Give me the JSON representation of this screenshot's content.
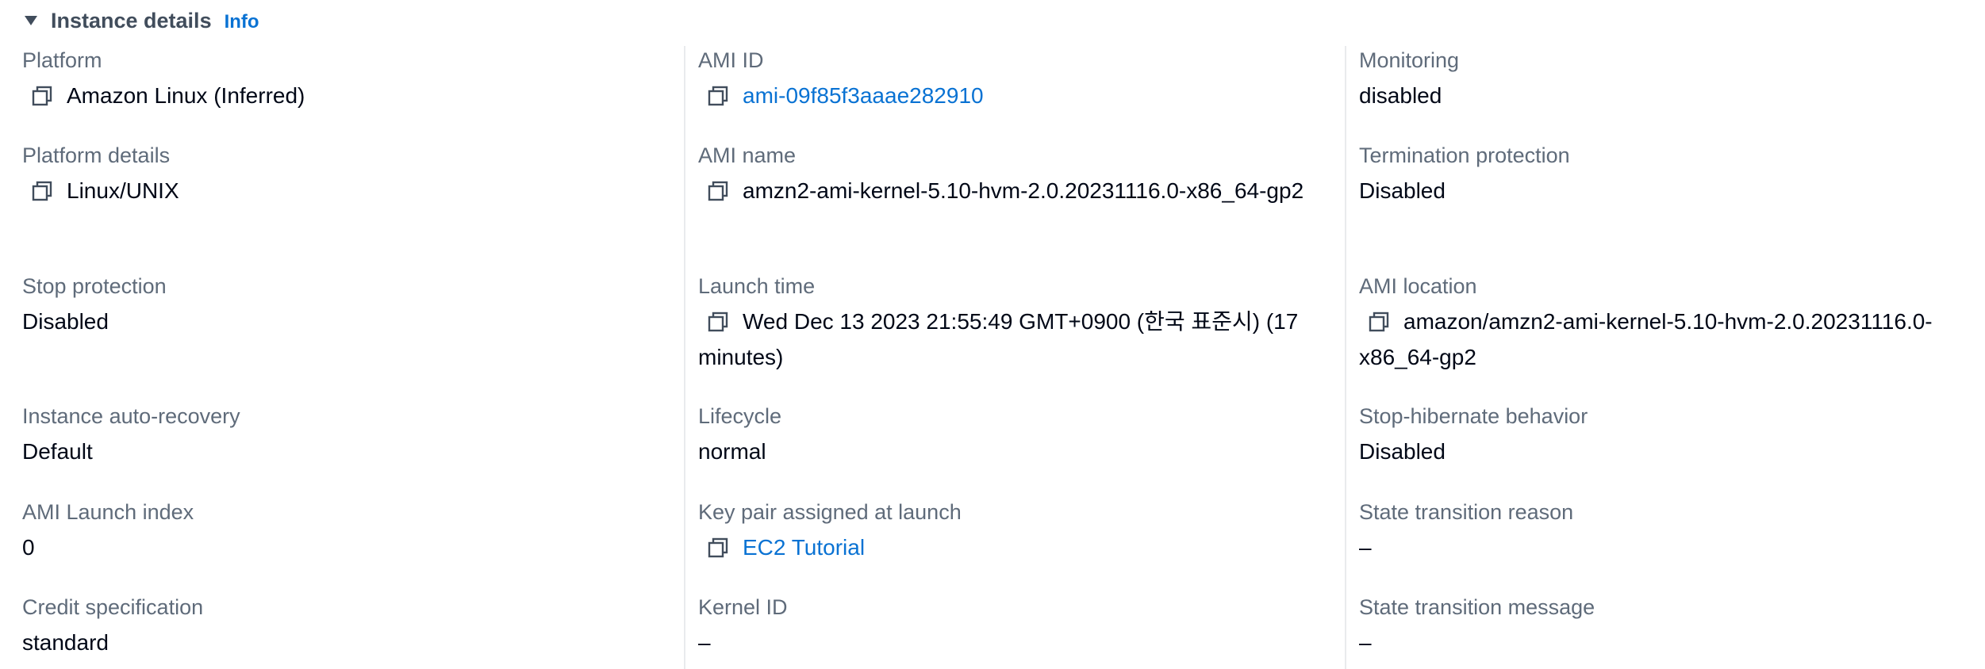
{
  "section": {
    "title": "Instance details",
    "info_label": "Info",
    "caret_icon": "caret-down-filled-icon"
  },
  "colors": {
    "label": "#5f6b7a",
    "value": "#000716",
    "link": "#0972d3",
    "header": "#414d5c",
    "divider": "#e9ebed"
  },
  "columns": [
    {
      "fields": [
        {
          "label": "Platform",
          "value": "Amazon Linux (Inferred)",
          "copyable": true,
          "link": false
        },
        {
          "label": "Platform details",
          "value": "Linux/UNIX",
          "copyable": true,
          "link": false
        },
        {
          "label": "Stop protection",
          "value": "Disabled",
          "copyable": false,
          "link": false
        },
        {
          "label": "Instance auto-recovery",
          "value": "Default",
          "copyable": false,
          "link": false
        },
        {
          "label": "AMI Launch index",
          "value": "0",
          "copyable": false,
          "link": false
        },
        {
          "label": "Credit specification",
          "value": "standard",
          "copyable": false,
          "link": false
        }
      ]
    },
    {
      "fields": [
        {
          "label": "AMI ID",
          "value": "ami-09f85f3aaae282910",
          "copyable": true,
          "link": true
        },
        {
          "label": "AMI name",
          "value": "amzn2-ami-kernel-5.10-hvm-2.0.20231116.0-x86_64-gp2",
          "copyable": true,
          "link": false
        },
        {
          "label": "Launch time",
          "value": "Wed Dec 13 2023 21:55:49 GMT+0900 (한국 표준시) (17 minutes)",
          "copyable": true,
          "link": false
        },
        {
          "label": "Lifecycle",
          "value": "normal",
          "copyable": false,
          "link": false
        },
        {
          "label": "Key pair assigned at launch",
          "value": "EC2 Tutorial",
          "copyable": true,
          "link": true
        },
        {
          "label": "Kernel ID",
          "value": "–",
          "copyable": false,
          "link": false
        }
      ]
    },
    {
      "fields": [
        {
          "label": "Monitoring",
          "value": "disabled",
          "copyable": false,
          "link": false
        },
        {
          "label": "Termination protection",
          "value": "Disabled",
          "copyable": false,
          "link": false
        },
        {
          "label": "AMI location",
          "value": "amazon/amzn2-ami-kernel-5.10-hvm-2.0.20231116.0-x86_64-gp2",
          "copyable": true,
          "link": false
        },
        {
          "label": "Stop-hibernate behavior",
          "value": "Disabled",
          "copyable": false,
          "link": false
        },
        {
          "label": "State transition reason",
          "value": "–",
          "copyable": false,
          "link": false
        },
        {
          "label": "State transition message",
          "value": "–",
          "copyable": false,
          "link": false
        }
      ]
    }
  ]
}
